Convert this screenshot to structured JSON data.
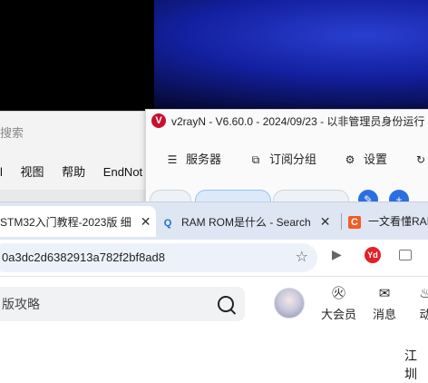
{
  "background_window": {
    "search_placeholder": "搜索",
    "menu": [
      "l",
      "视图",
      "帮助",
      "EndNot"
    ]
  },
  "v2rayn": {
    "logo_letter": "V",
    "title": "v2rayN - V6.60.0 - 2024/09/23 - 以非管理员身份运行",
    "toolbar": [
      {
        "icon": "server-list-icon",
        "glyph": "☰",
        "label": "服务器"
      },
      {
        "icon": "subscription-icon",
        "glyph": "⧉",
        "label": "订阅分组"
      },
      {
        "icon": "gear-icon",
        "glyph": "⚙",
        "label": "设置"
      },
      {
        "icon": "refresh-icon",
        "glyph": "↻",
        "label": ""
      }
    ]
  },
  "browser": {
    "tabs": [
      {
        "title": "STM32入门教程-2023版 细",
        "active": true
      },
      {
        "favicon": "Q",
        "title": "RAM ROM是什么 - Search",
        "active": false
      },
      {
        "favicon": "C",
        "title": "一文看懂RAI",
        "active": false
      }
    ],
    "url": "0a3dc2d6382913a782f2bf8ad8",
    "extension_yd": "Yd"
  },
  "page": {
    "search_text": "版攻略",
    "nav": [
      {
        "icon": "vip-icon",
        "glyph": "㊋",
        "label": "大会员"
      },
      {
        "icon": "message-icon",
        "glyph": "✉",
        "label": "消息"
      },
      {
        "icon": "dynamic-icon",
        "glyph": "♨",
        "label": "动"
      }
    ],
    "bottom_text": "江圳"
  },
  "colors": {
    "tab_bar": "#dfe6f3",
    "v2ray_red": "#c8102e",
    "accent_blue": "#2a6fe0"
  }
}
